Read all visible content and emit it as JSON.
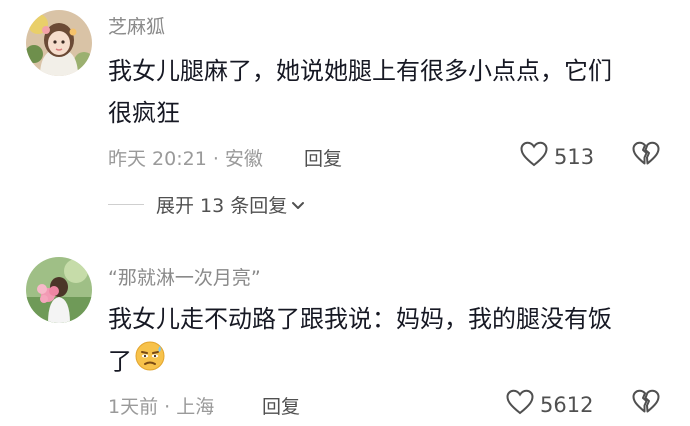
{
  "comments": [
    {
      "username": "芝麻狐",
      "text_line1": "我女儿腿麻了，她说她腿上有很多小点点，它们",
      "text_line2": "很疯狂",
      "time_location": "昨天 20:21 · 安徽",
      "reply_label": "回复",
      "likes": "513",
      "expand_label": "展开 13 条回复"
    },
    {
      "username": "“那就淋一次月亮”",
      "text_line1": "我女儿走不动路了跟我说：妈妈，我的腿没有饭",
      "text_line2": "了",
      "emoji": "sweat-face-emoji",
      "time_location": "1天前 · 上海",
      "reply_label": "回复",
      "likes": "5612"
    }
  ],
  "icons": {
    "like": "heart-outline-icon",
    "dislike": "broken-heart-icon",
    "expand": "chevron-down-icon"
  },
  "colors": {
    "username": "#8a8a8a",
    "text": "#161823",
    "meta": "#9a9a9a",
    "action": "#505050"
  }
}
